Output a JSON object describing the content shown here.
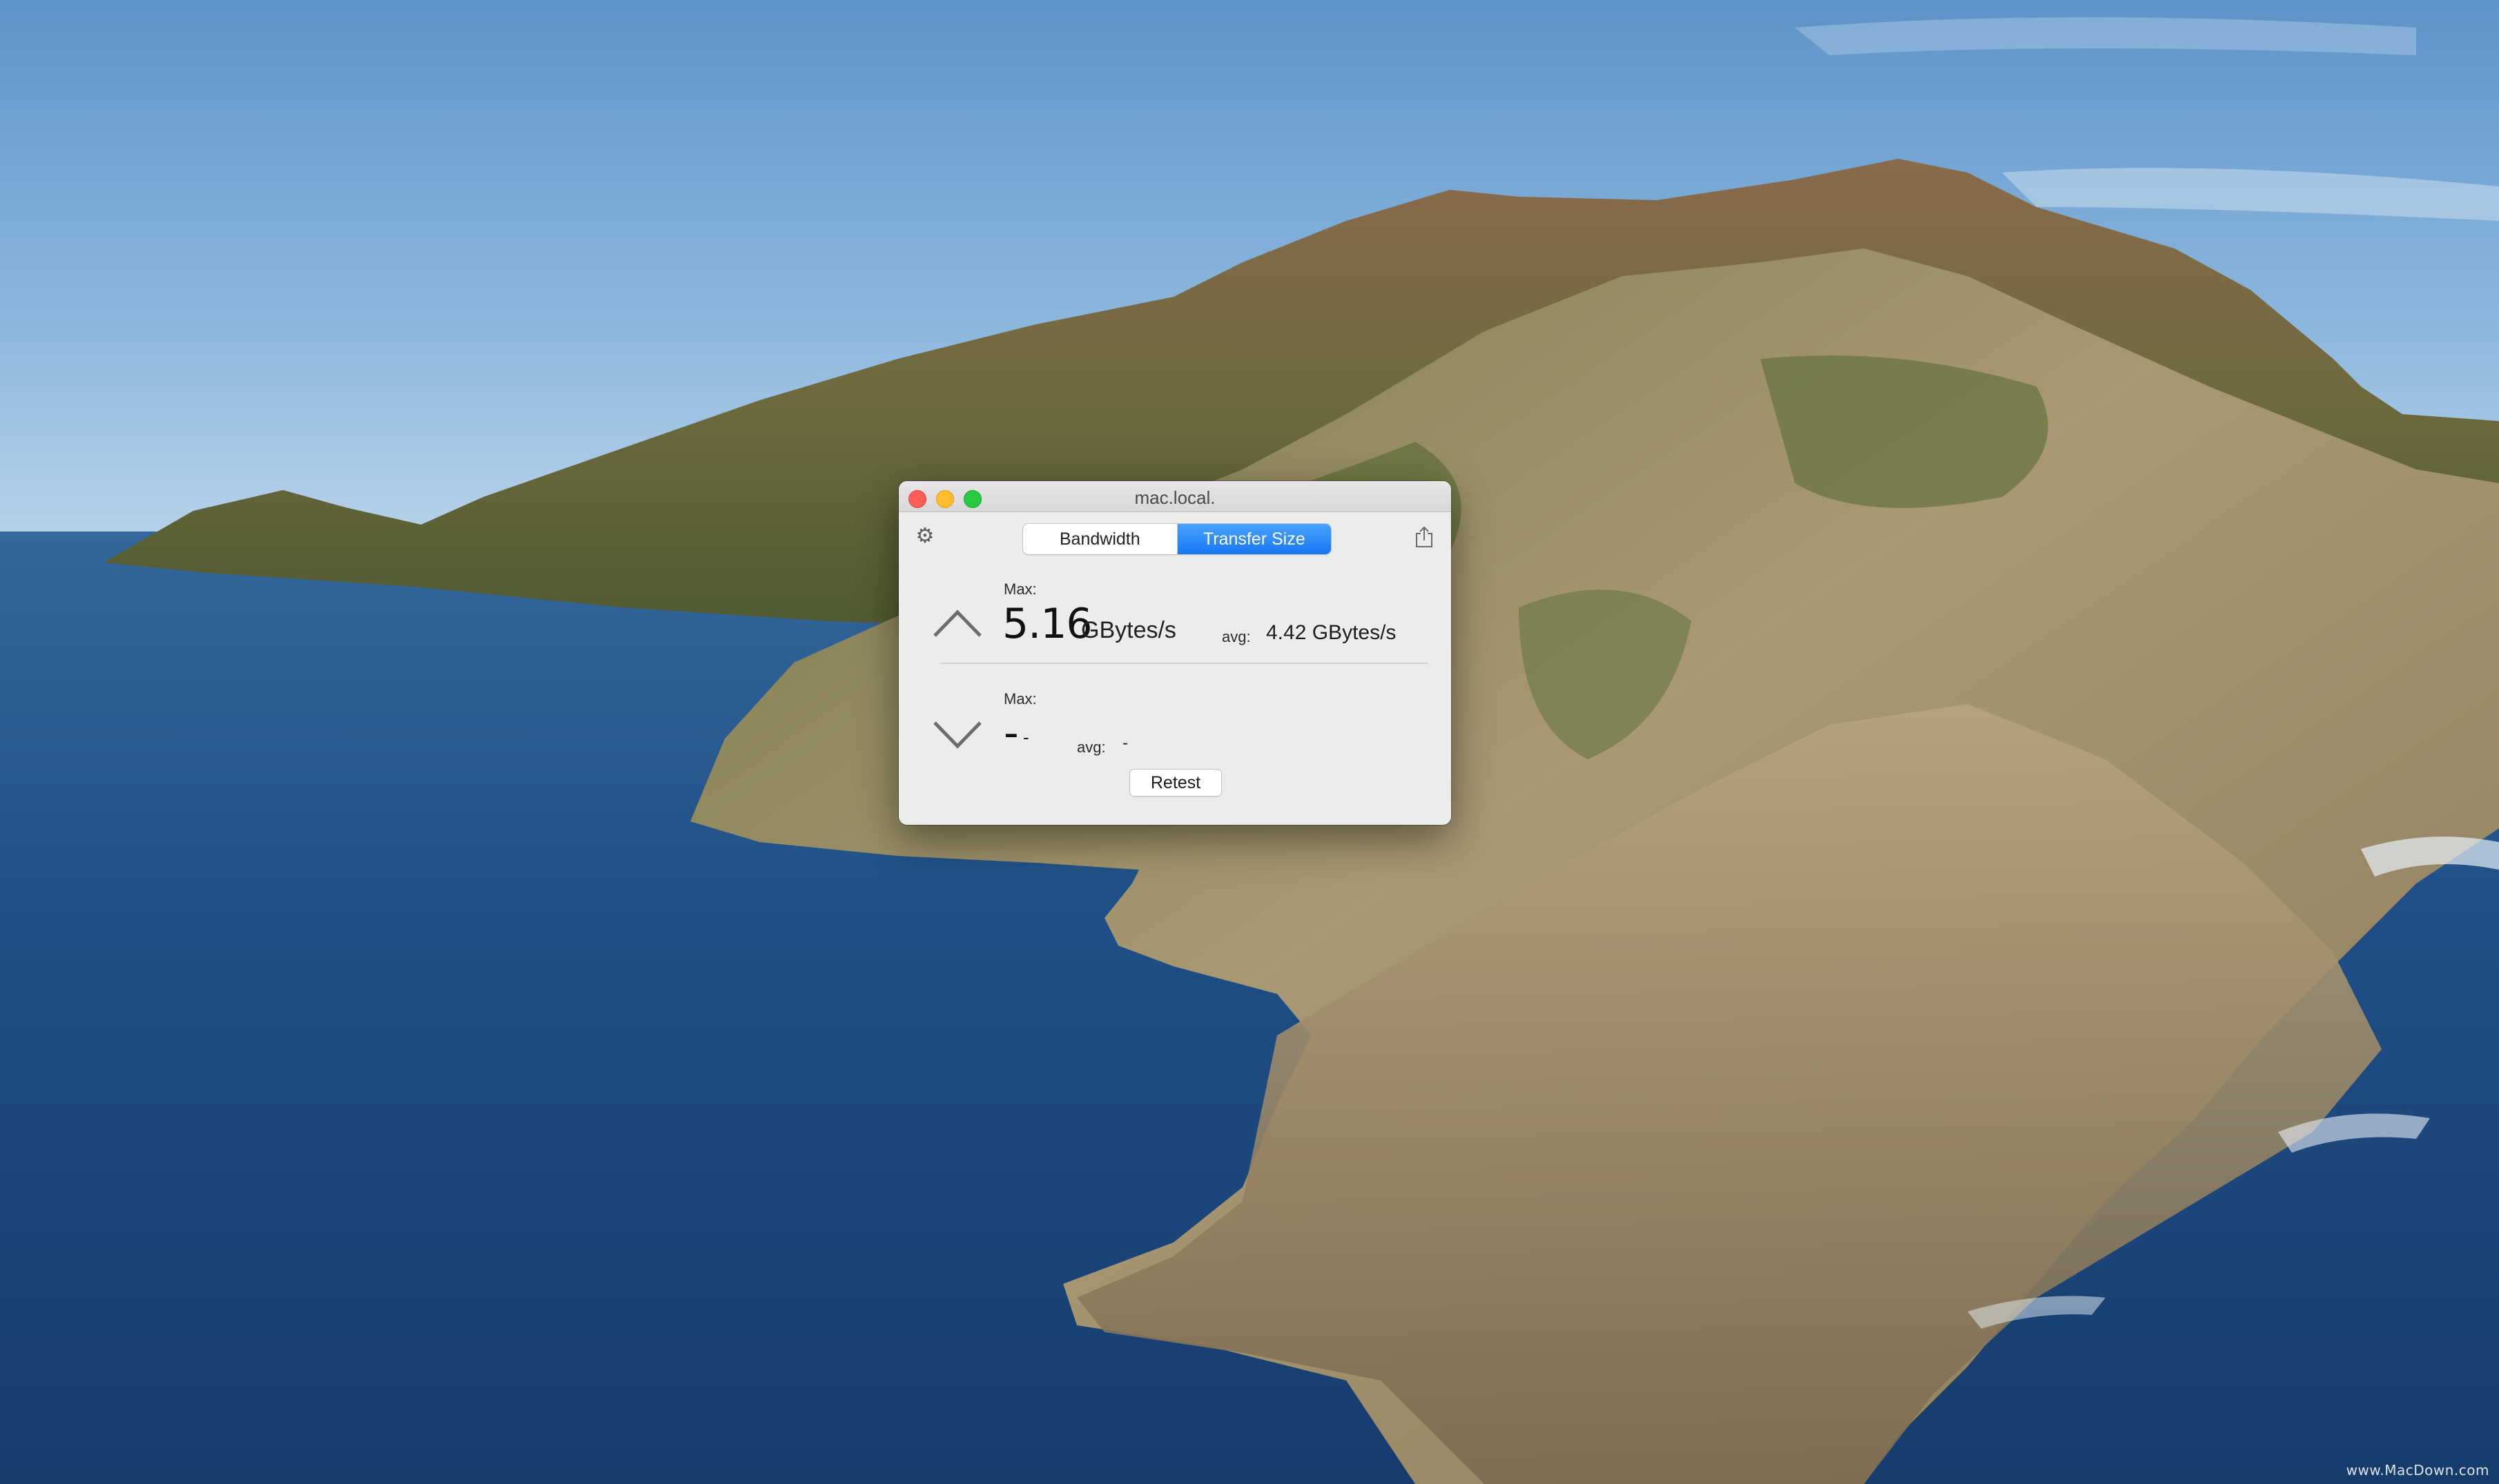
{
  "window": {
    "title": "mac.local."
  },
  "toolbar": {
    "settings_icon": "gear-icon",
    "share_icon": "share-icon",
    "segments": [
      {
        "label": "Bandwidth",
        "selected": false
      },
      {
        "label": "Transfer Size",
        "selected": true
      }
    ]
  },
  "upload": {
    "icon": "chevron-up-icon",
    "max_label": "Max:",
    "max_value": "5.16",
    "unit": "GBytes/s",
    "avg_label": "avg:",
    "avg_value": "4.42 GBytes/s"
  },
  "download": {
    "icon": "chevron-down-icon",
    "max_label": "Max:",
    "max_value": "-",
    "unit": "-",
    "avg_label": "avg:",
    "avg_value": "-"
  },
  "actions": {
    "retest_label": "Retest"
  },
  "desktop": {
    "watermark": "www.MacDown.com"
  },
  "colors": {
    "accent": "#1677f2",
    "close": "#ff5f57",
    "minimize": "#febc2e",
    "maximize": "#28c840"
  }
}
